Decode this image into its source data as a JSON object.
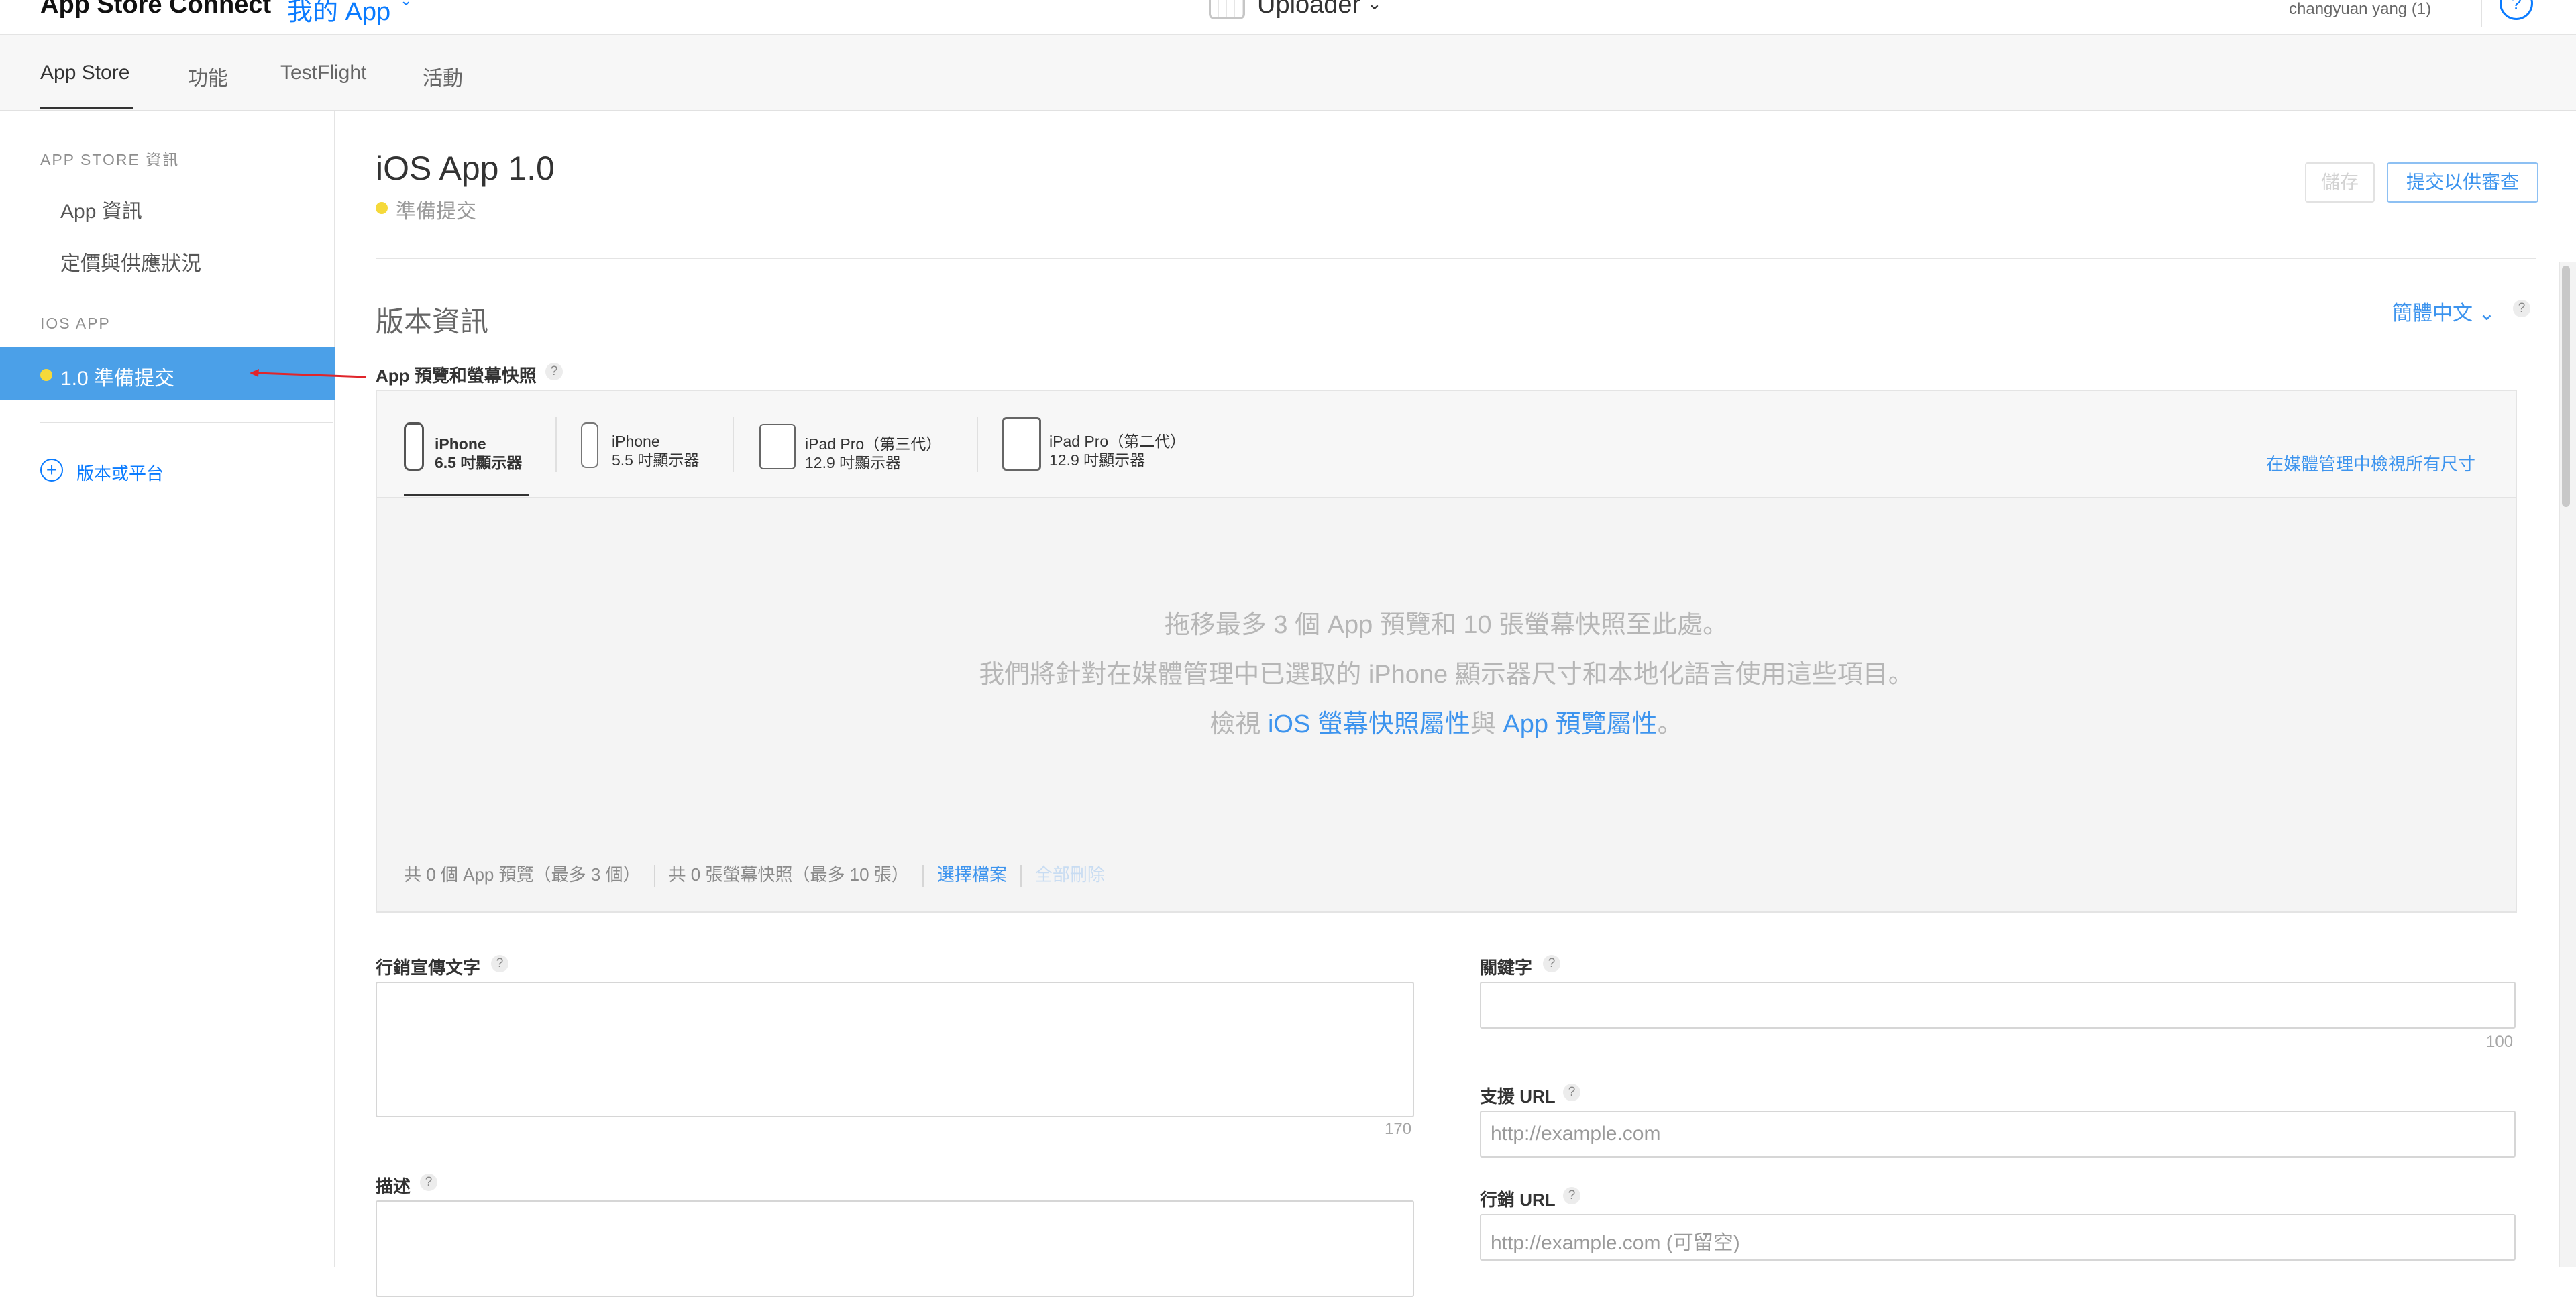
{
  "header": {
    "brand": "App Store Connect",
    "my_apps": "我的 App",
    "app_name": "Uploader",
    "user": "changyuan yang (1)",
    "help": "?"
  },
  "tabs": [
    {
      "label": "App Store",
      "active": true
    },
    {
      "label": "功能",
      "active": false
    },
    {
      "label": "TestFlight",
      "active": false
    },
    {
      "label": "活動",
      "active": false
    }
  ],
  "sidebar": {
    "section_app_store": "APP STORE 資訊",
    "item_app_info": "App 資訊",
    "item_pricing": "定價與供應狀況",
    "section_ios": "IOS APP",
    "active_item": "1.0 準備提交",
    "add_version": "版本或平台"
  },
  "page": {
    "title": "iOS App 1.0",
    "status": "準備提交",
    "save_button": "儲存",
    "submit_button": "提交以供審查",
    "section_title": "版本資訊",
    "language": "簡體中文",
    "help_mark": "?"
  },
  "media": {
    "label": "App 預覽和螢幕快照",
    "devices": [
      {
        "name": "iPhone",
        "size": "6.5 吋顯示器"
      },
      {
        "name": "iPhone",
        "size": "5.5 吋顯示器"
      },
      {
        "name": "iPad Pro（第三代）",
        "size": "12.9 吋顯示器"
      },
      {
        "name": "iPad Pro（第二代）",
        "size": "12.9 吋顯示器"
      }
    ],
    "view_all": "在媒體管理中檢視所有尺寸",
    "drop_line1": "拖移最多 3 個 App 預覽和 10 張螢幕快照至此處。",
    "drop_line2": "我們將針對在媒體管理中已選取的 iPhone 顯示器尺寸和本地化語言使用這些項目。",
    "drop_line3_prefix": "檢視 ",
    "drop_line3_link1": "iOS 螢幕快照屬性",
    "drop_line3_mid": "與 ",
    "drop_line3_link2": "App 預覽屬性",
    "drop_line3_suffix": "。",
    "preview_count": "共 0 個 App 預覽（最多 3 個）",
    "screenshot_count": "共 0 張螢幕快照（最多 10 張）",
    "choose_file": "選擇檔案",
    "delete_all": "全部刪除"
  },
  "form": {
    "promo_label": "行銷宣傳文字",
    "promo_limit": "170",
    "description_label": "描述",
    "keywords_label": "關鍵字",
    "keywords_limit": "100",
    "support_url_label": "支援 URL",
    "support_url_placeholder": "http://example.com",
    "marketing_url_label": "行銷 URL",
    "marketing_url_placeholder": "http://example.com (可留空)"
  },
  "colors": {
    "accent": "#0a7bff",
    "sidebar_active": "#4ba0e8",
    "status_yellow": "#f5d93a",
    "annotation_arrow": "#e0252b"
  }
}
